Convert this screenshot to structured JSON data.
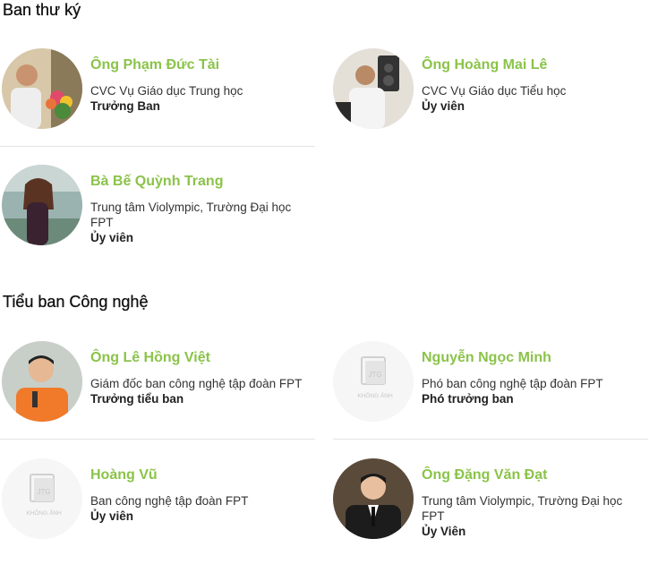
{
  "sections": [
    {
      "title": "Ban thư ký",
      "members": [
        {
          "name": "Ông Phạm Đức Tài",
          "desc": "CVC Vụ Giáo dục Trung học",
          "role": "Trưởng Ban",
          "avatar": "person-photo-icon"
        },
        {
          "name": "Ông Hoàng Mai Lê",
          "desc": "CVC Vụ Giáo dục Tiểu học",
          "role": "Ủy viên",
          "avatar": "person-photo-icon"
        },
        {
          "name": "Bà Bế Quỳnh Trang",
          "desc": "Trung tâm Violympic, Trường Đại học FPT",
          "role": "Ủy viên",
          "avatar": "person-photo-icon"
        }
      ]
    },
    {
      "title": "Tiểu ban Công nghệ",
      "members": [
        {
          "name": "Ông Lê Hồng Việt",
          "desc": "Giám đốc ban công nghệ tập đoàn FPT",
          "role": "Trưởng tiểu ban",
          "avatar": "person-photo-icon"
        },
        {
          "name": "Nguyễn Ngọc Minh",
          "desc": "Phó ban công nghệ tập đoàn FPT",
          "role": "Phó trưởng ban",
          "avatar": "no-image-placeholder-icon",
          "placeholder_text": "KHÔNG ẢNH"
        },
        {
          "name": "Hoàng Vũ",
          "desc": "Ban công nghệ tập đoàn FPT",
          "role": "Ủy viên",
          "avatar": "no-image-placeholder-icon",
          "placeholder_text": "KHÔNG ẢNH"
        },
        {
          "name": "Ông Đặng Văn Đạt",
          "desc": "Trung tâm Violympic, Trường Đại học FPT",
          "role": "Ủy Viên",
          "avatar": "person-photo-icon"
        }
      ]
    }
  ],
  "colors": {
    "accent": "#8bc34a",
    "divider": "#e4e4e4",
    "text": "#333333"
  }
}
